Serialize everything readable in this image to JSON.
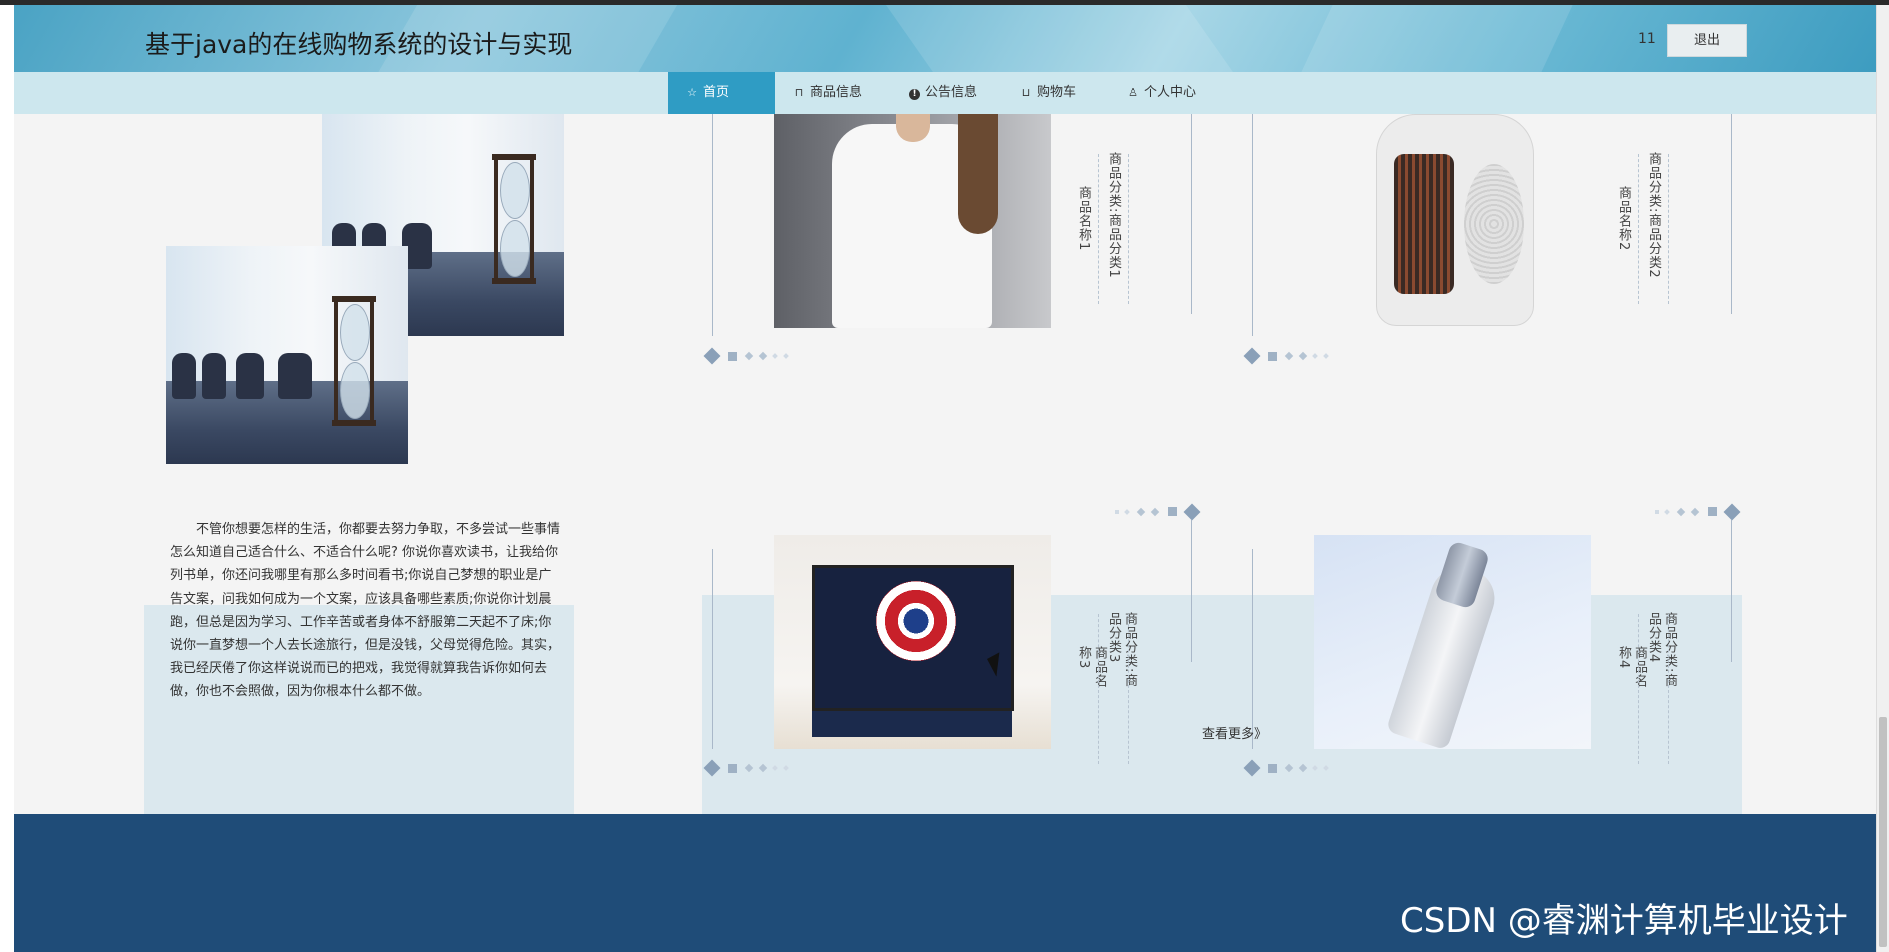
{
  "header": {
    "title": "基于java的在线购物系统的设计与实现",
    "username": "11",
    "logout_label": "退出"
  },
  "nav": [
    {
      "label": "首页",
      "icon": "star-icon",
      "active": true
    },
    {
      "label": "商品信息",
      "icon": "bag-icon",
      "active": false
    },
    {
      "label": "公告信息",
      "icon": "info-icon",
      "active": false
    },
    {
      "label": "购物车",
      "icon": "cart-icon",
      "active": false
    },
    {
      "label": "个人中心",
      "icon": "user-icon",
      "active": false
    }
  ],
  "intro": {
    "paragraph": "不管你想要怎样的生活，你都要去努力争取，不多尝试一些事情怎么知道自己适合什么、不适合什么呢? 你说你喜欢读书，让我给你列书单，你还问我哪里有那么多时间看书;你说自己梦想的职业是广告文案，问我如何成为一个文案，应该具备哪些素质;你说你计划晨跑，但总是因为学习、工作辛苦或者身体不舒服第二天起不了床;你说你一直梦想一个人去长途旅行，但是没钱，父母觉得危险。其实，我已经厌倦了你这样说说而已的把戏，我觉得就算我告诉你如何去做，你也不会照做，因为你根本什么都不做。",
    "image_subject": "hourglass on conference table"
  },
  "products": [
    {
      "name": "商品名称1",
      "category": "商品分类:商品分类1",
      "image_subject": "white t-shirt"
    },
    {
      "name": "商品名称2",
      "category": "商品分类:商品分类2",
      "image_subject": "white space heater"
    },
    {
      "name": "商品名称3",
      "category": "商品分类:商品分类3",
      "image_subject": "captain america shield monitor"
    },
    {
      "name": "商品名称4",
      "category": "商品分类:商品分类4",
      "image_subject": "cosmetic bottle"
    }
  ],
  "more_label": "查看更多》",
  "watermark": "CSDN @睿渊计算机毕业设计",
  "colors": {
    "nav_active": "#2f9cc4",
    "footer": "#1f4c78",
    "nav_bg": "#cde7ee"
  }
}
